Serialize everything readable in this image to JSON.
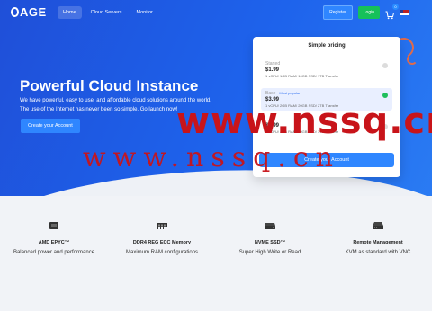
{
  "header": {
    "logo_text": "AGE",
    "nav": [
      "Home",
      "Cloud Servers",
      "Monitor"
    ],
    "register_label": "Register",
    "login_label": "Login",
    "cart_count": "0",
    "flag_icon": "us-flag-icon"
  },
  "hero": {
    "title": "Powerful Cloud Instance",
    "subtitle_line1": "We have powerful, easy to use, and affordable cloud solutions around the world.",
    "subtitle_line2": "The use of the Internet has never been so simple. Go launch now!",
    "cta_label": "Create your Account"
  },
  "pricing": {
    "title": "Simple pricing",
    "plans": [
      {
        "name": "Started",
        "tag": "",
        "price": "$1.99",
        "spec": "1 vCPU/ 1GB RAM/ 10GB SSD/ 1TB Transfer",
        "selected": false
      },
      {
        "name": "Base",
        "tag": "Most popular",
        "price": "$3.99",
        "spec": "1 vCPU/ 2GB RAM/ 20GB SSD/ 2TB Transfer",
        "selected": true
      },
      {
        "name": "",
        "tag": "",
        "price": "$5.99",
        "spec": "2 vCPU/ 4GB RAM/ 40GB SSD/ 3TB Transfer",
        "selected": false
      }
    ],
    "create_label": "Create your Account"
  },
  "features": [
    {
      "icon": "cpu-icon",
      "title": "AMD EPYC™",
      "desc": "Balanced power and performance"
    },
    {
      "icon": "ram-icon",
      "title": "DDR4 REG ECC Memory",
      "desc": "Maximum RAM configurations"
    },
    {
      "icon": "ssd-icon",
      "title": "NVME SSD™",
      "desc": "Super High Write or Read"
    },
    {
      "icon": "kvm-icon",
      "title": "Remote Management",
      "desc": "KVM as standard with VNC"
    }
  ],
  "watermark": {
    "line1": "www.nssq.cn",
    "line2": "www.nssq.cn"
  },
  "colors": {
    "hero_start": "#1f4fd8",
    "hero_end": "#2a7bf3",
    "accent_blue": "#2f86ff",
    "login_green": "#16c15a",
    "watermark_red": "#c8141a"
  }
}
